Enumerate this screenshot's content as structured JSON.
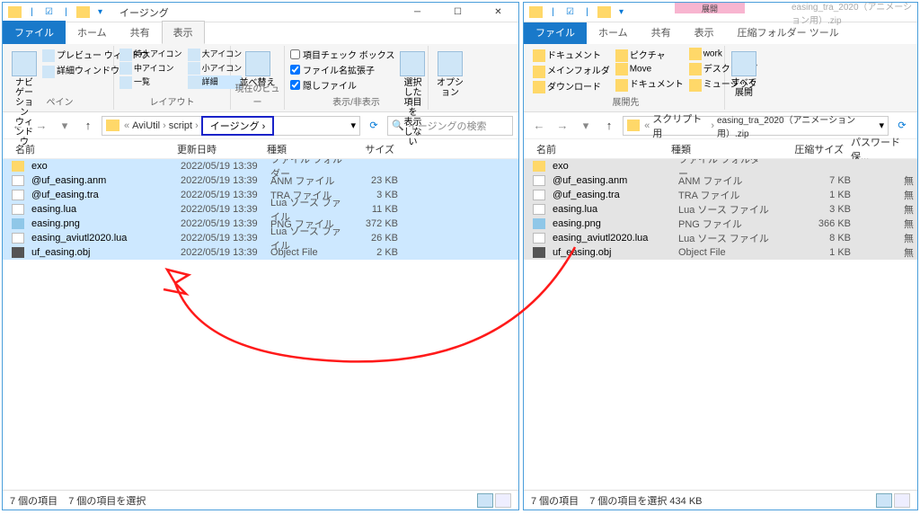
{
  "left": {
    "title": "イージング",
    "tabs": {
      "file": "ファイル",
      "home": "ホーム",
      "share": "共有",
      "view": "表示"
    },
    "ribbon": {
      "pane": {
        "nav": "ナビゲーション\nウィンドウ",
        "preview": "プレビュー ウィンドウ",
        "details": "詳細ウィンドウ",
        "label": "ペイン"
      },
      "layout": {
        "xl": "特大アイコン",
        "l": "大アイコン",
        "m": "中アイコン",
        "s": "小アイコン",
        "list": "一覧",
        "detail": "詳細",
        "label": "レイアウト"
      },
      "current": {
        "sort": "並べ替え",
        "label": "現在のビュー"
      },
      "showhide": {
        "chk1": "項目チェック ボックス",
        "chk2": "ファイル名拡張子",
        "chk3": "隠しファイル",
        "hide": "選択した項目を\n表示しない",
        "label": "表示/非表示"
      },
      "options": {
        "btn": "オプション"
      }
    },
    "breadcrumb": [
      "AviUtil",
      "script",
      "イージング"
    ],
    "search_placeholder": "イージングの検索",
    "columns": {
      "name": "名前",
      "date": "更新日時",
      "type": "種類",
      "size": "サイズ"
    },
    "files": [
      {
        "icon": "folder",
        "name": "exo",
        "date": "2022/05/19 13:39",
        "type": "ファイル フォルダー",
        "size": ""
      },
      {
        "icon": "file",
        "name": "@uf_easing.anm",
        "date": "2022/05/19 13:39",
        "type": "ANM ファイル",
        "size": "23 KB"
      },
      {
        "icon": "file",
        "name": "@uf_easing.tra",
        "date": "2022/05/19 13:39",
        "type": "TRA ファイル",
        "size": "3 KB"
      },
      {
        "icon": "file",
        "name": "easing.lua",
        "date": "2022/05/19 13:39",
        "type": "Lua ソース ファイル",
        "size": "11 KB"
      },
      {
        "icon": "png",
        "name": "easing.png",
        "date": "2022/05/19 13:39",
        "type": "PNG ファイル",
        "size": "372 KB"
      },
      {
        "icon": "file",
        "name": "easing_aviutl2020.lua",
        "date": "2022/05/19 13:39",
        "type": "Lua ソース ファイル",
        "size": "26 KB"
      },
      {
        "icon": "obj",
        "name": "uf_easing.obj",
        "date": "2022/05/19 13:39",
        "type": "Object File",
        "size": "2 KB"
      }
    ],
    "status": {
      "count": "7 個の項目",
      "selected": "7 個の項目を選択"
    }
  },
  "right": {
    "title": "easing_tra_2020（アニメーション用）.zip",
    "context_tab": "展開",
    "context_group": "圧縮フォルダー ツール",
    "tabs": {
      "file": "ファイル",
      "home": "ホーム",
      "share": "共有",
      "view": "表示"
    },
    "shortcuts": {
      "docs": "ドキュメント",
      "main": "メインフォルダ",
      "dl": "ダウンロード",
      "pics": "ピクチャ",
      "move": "Move",
      "doc2": "ドキュメント",
      "work": "work",
      "desk": "デスクトップ",
      "music": "ミュージック"
    },
    "extract_label": "展開先",
    "extract_btn": "すべて\n展開",
    "breadcrumb": [
      "スクリプト用",
      "easing_tra_2020（アニメーション用）.zip"
    ],
    "columns": {
      "name": "名前",
      "type": "種類",
      "csize": "圧縮サイズ",
      "pw": "パスワード保..."
    },
    "files": [
      {
        "icon": "folder",
        "name": "exo",
        "type": "ファイル フォルダー",
        "csize": "",
        "pw": ""
      },
      {
        "icon": "file",
        "name": "@uf_easing.anm",
        "type": "ANM ファイル",
        "csize": "7 KB",
        "pw": "無"
      },
      {
        "icon": "file",
        "name": "@uf_easing.tra",
        "type": "TRA ファイル",
        "csize": "1 KB",
        "pw": "無"
      },
      {
        "icon": "file",
        "name": "easing.lua",
        "type": "Lua ソース ファイル",
        "csize": "3 KB",
        "pw": "無"
      },
      {
        "icon": "png",
        "name": "easing.png",
        "type": "PNG ファイル",
        "csize": "366 KB",
        "pw": "無"
      },
      {
        "icon": "file",
        "name": "easing_aviutl2020.lua",
        "type": "Lua ソース ファイル",
        "csize": "8 KB",
        "pw": "無"
      },
      {
        "icon": "obj",
        "name": "uf_easing.obj",
        "type": "Object File",
        "csize": "1 KB",
        "pw": "無"
      }
    ],
    "status": {
      "count": "7 個の項目",
      "selected": "7 個の項目を選択 434 KB"
    }
  }
}
